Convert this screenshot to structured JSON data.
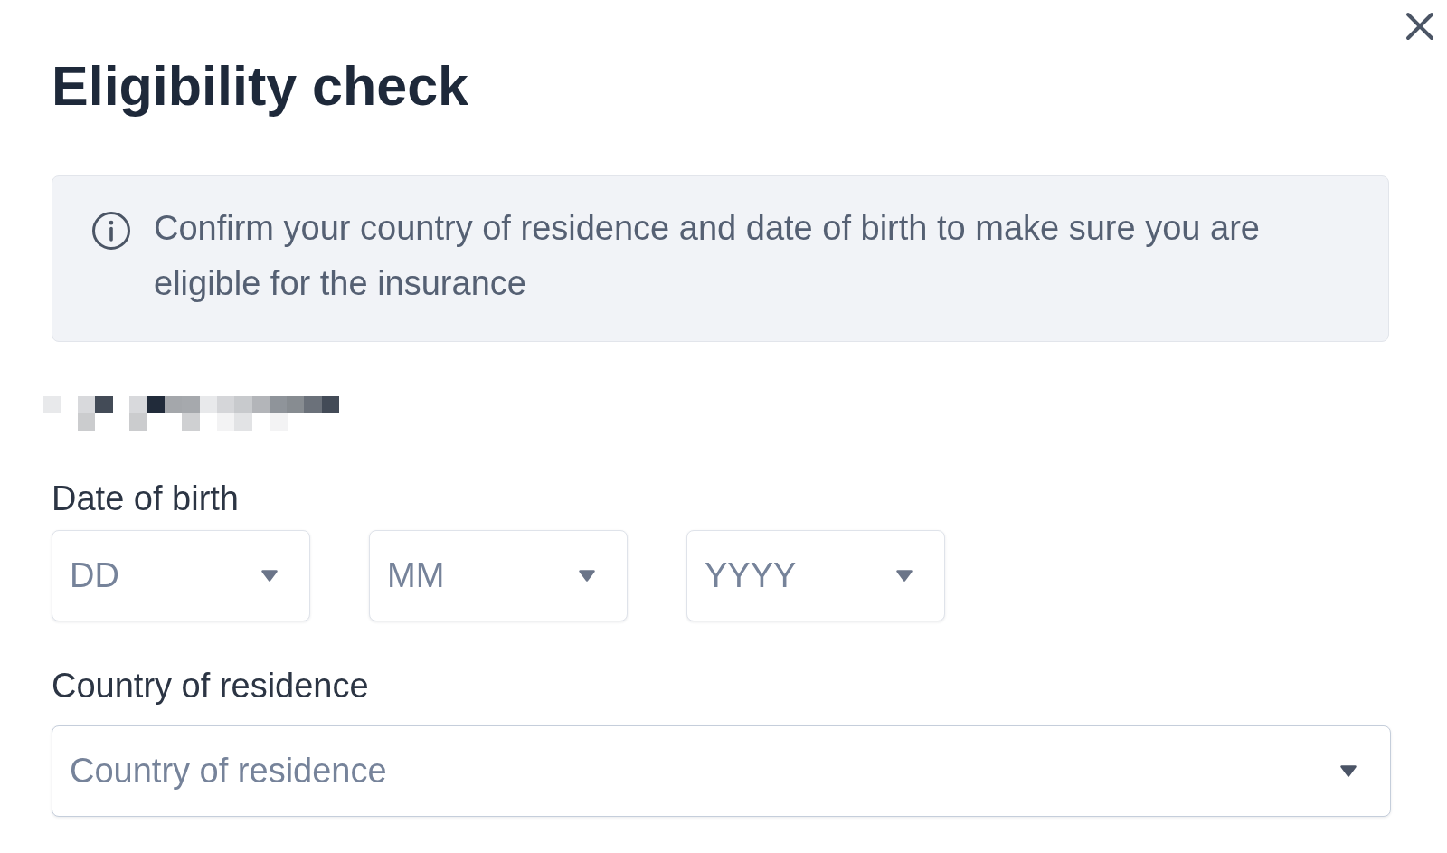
{
  "dialog": {
    "title": "Eligibility check"
  },
  "info_notice": {
    "text": "Confirm your country of residence and date of birth to make sure you are eligible for the insurance"
  },
  "date_of_birth": {
    "label": "Date of birth",
    "selects": [
      {
        "placeholder": "DD"
      },
      {
        "placeholder": "MM"
      },
      {
        "placeholder": "YYYY"
      }
    ]
  },
  "country_of_residence": {
    "label": "Country of residence",
    "select": {
      "placeholder": "Country of residence"
    }
  }
}
